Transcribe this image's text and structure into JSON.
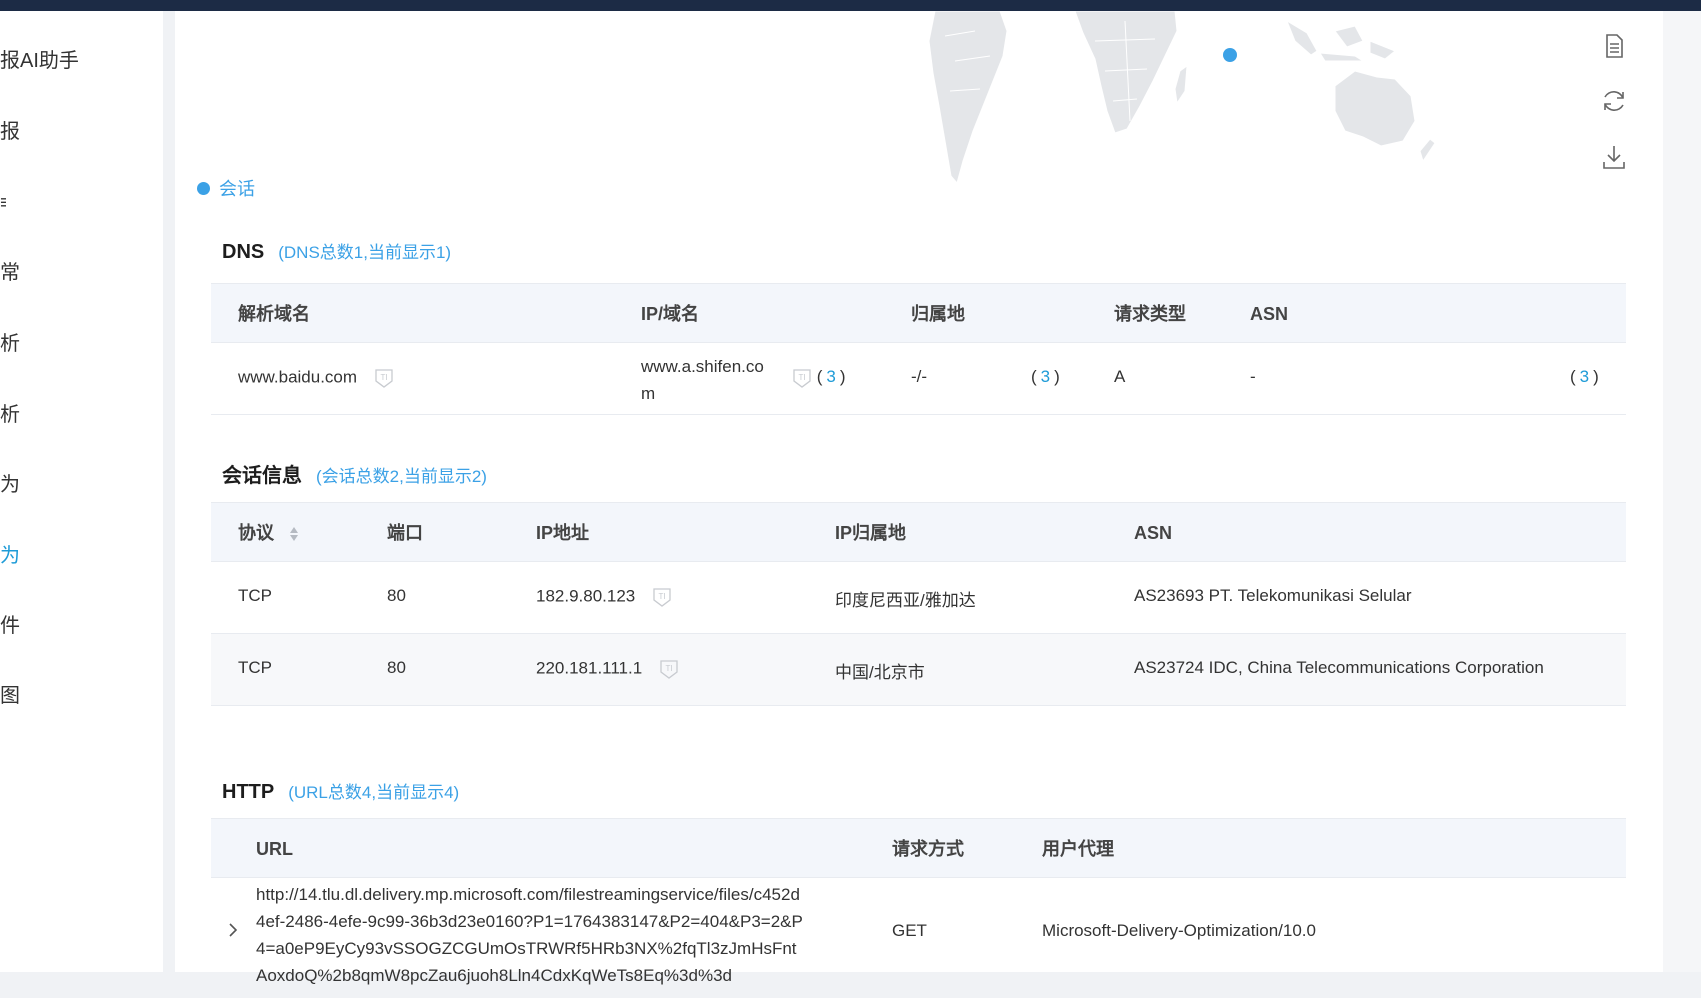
{
  "sidebar": {
    "items": [
      {
        "label": "报AI助手",
        "active": false
      },
      {
        "label": "报",
        "active": false
      },
      {
        "label": "≡",
        "active": false
      },
      {
        "label": "常",
        "active": false
      },
      {
        "label": "析",
        "active": false
      },
      {
        "label": "析",
        "active": false
      },
      {
        "label": "为",
        "active": false
      },
      {
        "label": "为",
        "active": true
      },
      {
        "label": "件",
        "active": false
      },
      {
        "label": "图",
        "active": false
      }
    ]
  },
  "map": {
    "legend_label": "会话"
  },
  "toolbar": {
    "icons": [
      "report-icon",
      "refresh-icon",
      "download-icon"
    ]
  },
  "dns": {
    "title": "DNS",
    "count": "(DNS总数1,当前显示1)",
    "headers": [
      "解析域名",
      "IP/域名",
      "归属地",
      "请求类型",
      "ASN"
    ],
    "rows": [
      {
        "domain": "www.baidu.com",
        "ip_line1": "www.a.shifen.co",
        "ip_line2": "m",
        "ip_count": "3",
        "location": "-/-",
        "loc_count": "3",
        "type": "A",
        "asn": "-",
        "asn_count": "3"
      }
    ]
  },
  "sessions": {
    "title": "会话信息",
    "count": "(会话总数2,当前显示2)",
    "headers": [
      "协议",
      "端口",
      "IP地址",
      "IP归属地",
      "ASN"
    ],
    "rows": [
      {
        "protocol": "TCP",
        "port": "80",
        "ip": "182.9.80.123",
        "location": "印度尼西亚/雅加达",
        "asn": "AS23693 PT. Telekomunikasi Selular"
      },
      {
        "protocol": "TCP",
        "port": "80",
        "ip": "220.181.111.1",
        "location": "中国/北京市",
        "asn": "AS23724 IDC, China Telecommunications Corporation"
      }
    ]
  },
  "http": {
    "title": "HTTP",
    "count": "(URL总数4,当前显示4)",
    "headers": [
      "URL",
      "请求方式",
      "用户代理"
    ],
    "rows": [
      {
        "url_lines": [
          "http://14.tlu.dl.delivery.mp.microsoft.com/filestreamingservice/files/c452d",
          "4ef-2486-4efe-9c99-36b3d23e0160?P1=1764383147&P2=404&P3=2&P",
          "4=a0eP9EyCy93vSSOGZCGUmOsTRWRf5HRb3NX%2fqTl3zJmHsFnt",
          "AoxdoQ%2b8qmW8pcZau6juoh8Lln4CdxKqWeTs8Eq%3d%3d"
        ],
        "method": "GET",
        "agent": "Microsoft-Delivery-Optimization/10.0"
      }
    ]
  }
}
